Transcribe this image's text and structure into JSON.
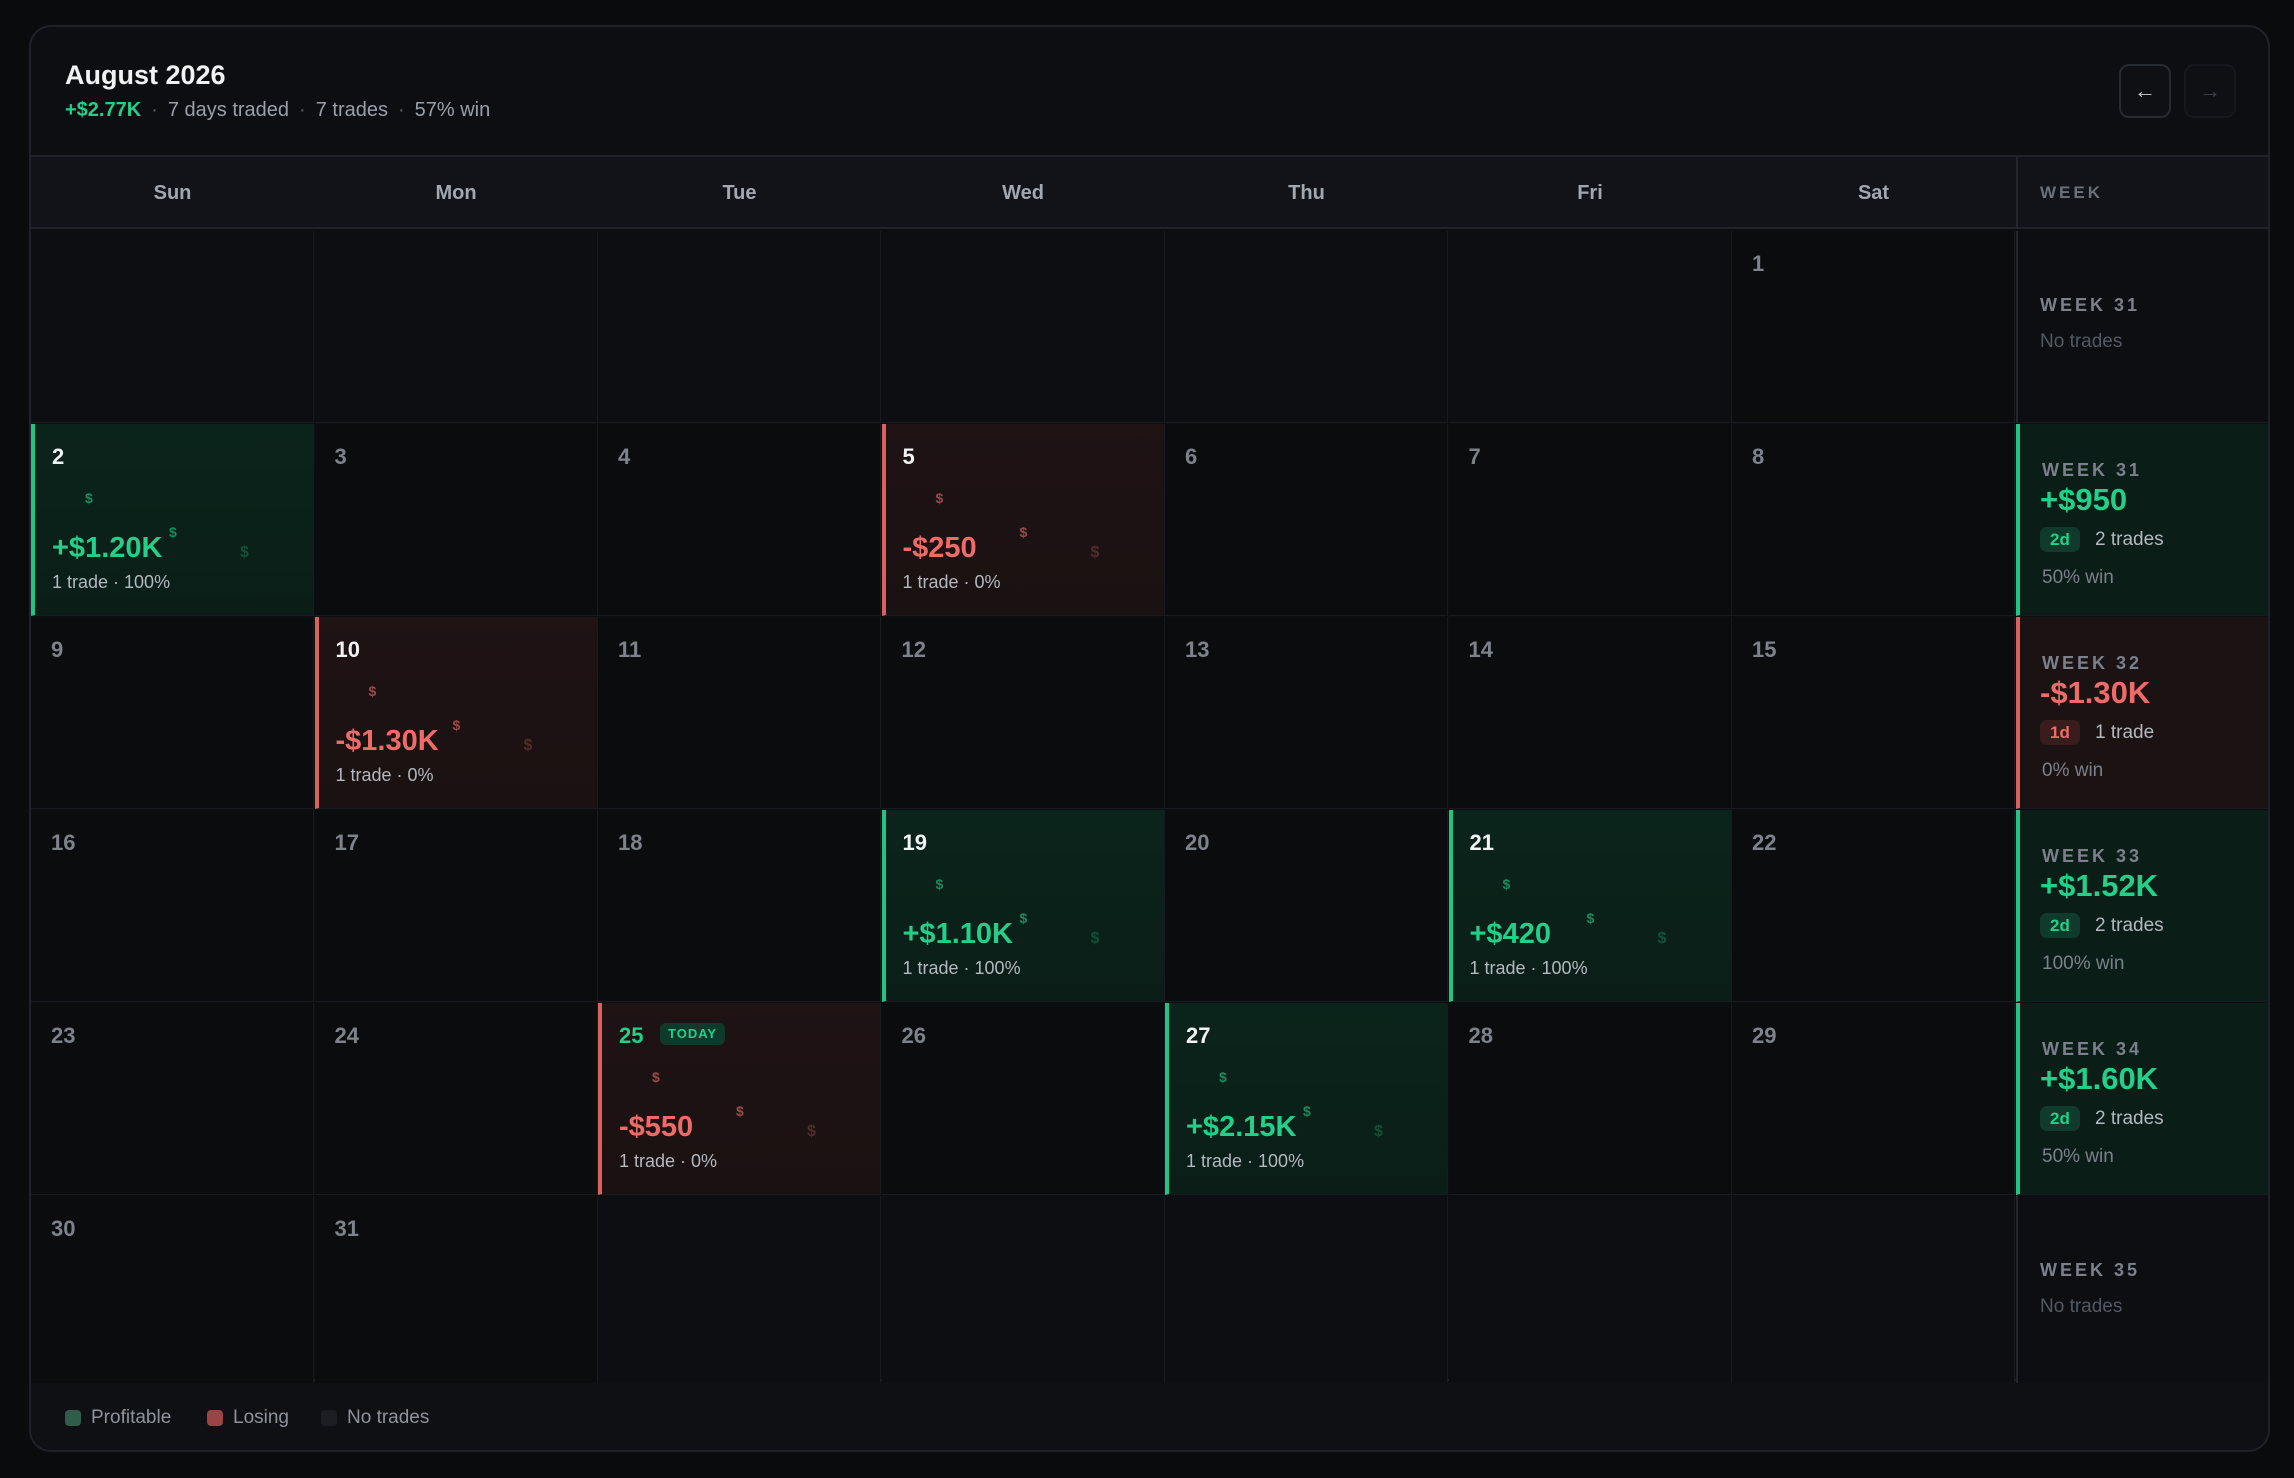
{
  "header": {
    "title": "August 2026",
    "summary_pnl": "+$2.77K",
    "days_traded": "7 days traded",
    "trades": "7 trades",
    "win_rate": "57% win",
    "separator": "·",
    "prev_icon": "arrow-left-icon",
    "next_icon": "arrow-right-icon",
    "prev_glyph": "←",
    "next_glyph": "→"
  },
  "weekdays": [
    "Sun",
    "Mon",
    "Tue",
    "Wed",
    "Thu",
    "Fri",
    "Sat"
  ],
  "week_column_label": "WEEK",
  "colors": {
    "profit": "#22d08a",
    "loss": "#ee6b67",
    "background": "#0a0b0d"
  },
  "days": [
    {
      "day": "1",
      "status": "none",
      "row": 0,
      "col": 6
    },
    {
      "day": "2",
      "status": "win",
      "pnl": "+$1.20K",
      "meta": "1 trade · 100%",
      "row": 1,
      "col": 0
    },
    {
      "day": "3",
      "status": "none",
      "row": 1,
      "col": 1
    },
    {
      "day": "4",
      "status": "none",
      "row": 1,
      "col": 2
    },
    {
      "day": "5",
      "status": "loss",
      "pnl": "-$250",
      "meta": "1 trade · 0%",
      "row": 1,
      "col": 3
    },
    {
      "day": "6",
      "status": "none",
      "row": 1,
      "col": 4
    },
    {
      "day": "7",
      "status": "none",
      "row": 1,
      "col": 5
    },
    {
      "day": "8",
      "status": "none",
      "row": 1,
      "col": 6
    },
    {
      "day": "9",
      "status": "none",
      "row": 2,
      "col": 0
    },
    {
      "day": "10",
      "status": "loss",
      "pnl": "-$1.30K",
      "meta": "1 trade · 0%",
      "row": 2,
      "col": 1
    },
    {
      "day": "11",
      "status": "none",
      "row": 2,
      "col": 2
    },
    {
      "day": "12",
      "status": "none",
      "row": 2,
      "col": 3
    },
    {
      "day": "13",
      "status": "none",
      "row": 2,
      "col": 4
    },
    {
      "day": "14",
      "status": "none",
      "row": 2,
      "col": 5
    },
    {
      "day": "15",
      "status": "none",
      "row": 2,
      "col": 6
    },
    {
      "day": "16",
      "status": "none",
      "row": 3,
      "col": 0
    },
    {
      "day": "17",
      "status": "none",
      "row": 3,
      "col": 1
    },
    {
      "day": "18",
      "status": "none",
      "row": 3,
      "col": 2
    },
    {
      "day": "19",
      "status": "win",
      "pnl": "+$1.10K",
      "meta": "1 trade · 100%",
      "row": 3,
      "col": 3
    },
    {
      "day": "20",
      "status": "none",
      "row": 3,
      "col": 4
    },
    {
      "day": "21",
      "status": "win",
      "pnl": "+$420",
      "meta": "1 trade · 100%",
      "row": 3,
      "col": 5
    },
    {
      "day": "22",
      "status": "none",
      "row": 3,
      "col": 6
    },
    {
      "day": "23",
      "status": "none",
      "row": 4,
      "col": 0
    },
    {
      "day": "24",
      "status": "none",
      "row": 4,
      "col": 1
    },
    {
      "day": "25",
      "status": "loss",
      "pnl": "-$550",
      "meta": "1 trade · 0%",
      "today": true,
      "today_label": "TODAY",
      "row": 4,
      "col": 2
    },
    {
      "day": "26",
      "status": "none",
      "row": 4,
      "col": 3
    },
    {
      "day": "27",
      "status": "win",
      "pnl": "+$2.15K",
      "meta": "1 trade · 100%",
      "row": 4,
      "col": 4
    },
    {
      "day": "28",
      "status": "none",
      "row": 4,
      "col": 5
    },
    {
      "day": "29",
      "status": "none",
      "row": 4,
      "col": 6
    },
    {
      "day": "30",
      "status": "none",
      "row": 5,
      "col": 0
    },
    {
      "day": "31",
      "status": "none",
      "row": 5,
      "col": 1
    }
  ],
  "weeks": [
    {
      "label": "WEEK 31",
      "status": "empty",
      "empty_text": "No trades"
    },
    {
      "label": "WEEK 31",
      "status": "win",
      "pnl": "+$950",
      "days": "2d",
      "trades": "2 trades",
      "win": "50% win"
    },
    {
      "label": "WEEK 32",
      "status": "loss",
      "pnl": "-$1.30K",
      "days": "1d",
      "trades": "1 trade",
      "win": "0% win"
    },
    {
      "label": "WEEK 33",
      "status": "win",
      "pnl": "+$1.52K",
      "days": "2d",
      "trades": "2 trades",
      "win": "100% win"
    },
    {
      "label": "WEEK 34",
      "status": "win",
      "pnl": "+$1.60K",
      "days": "2d",
      "trades": "2 trades",
      "win": "50% win"
    },
    {
      "label": "WEEK 35",
      "status": "empty",
      "empty_text": "No trades"
    }
  ],
  "legend": [
    {
      "label": "Profitable",
      "color": "#2f5d49"
    },
    {
      "label": "Losing",
      "color": "#9a4446"
    },
    {
      "label": "No trades",
      "color": "#1c1e24"
    }
  ]
}
